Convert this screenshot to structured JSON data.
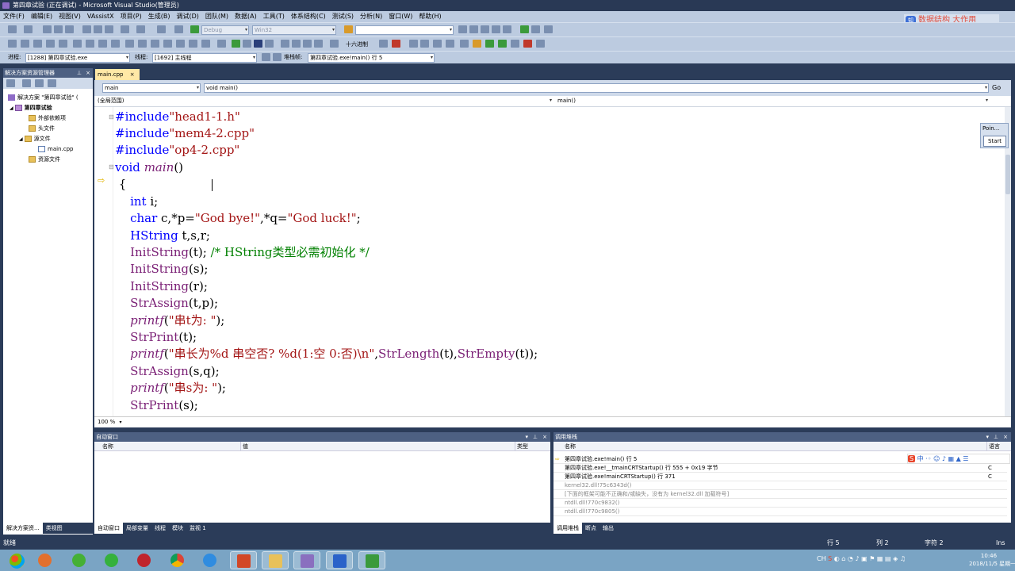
{
  "window": {
    "title": "第四章试验 (正在调试) - Microsoft Visual Studio(管理员)"
  },
  "menu": [
    "文件(F)",
    "编辑(E)",
    "视图(V)",
    "VAssistX",
    "项目(P)",
    "生成(B)",
    "调试(D)",
    "团队(M)",
    "数据(A)",
    "工具(T)",
    "体系结构(C)",
    "测试(S)",
    "分析(N)",
    "窗口(W)",
    "帮助(H)"
  ],
  "toolbar": {
    "config": "Debug",
    "platform": "Win32",
    "hex_label": "十六进制",
    "process_label": "进程:",
    "process_value": "[1288] 第四章试验.exe",
    "thread_label": "线程:",
    "thread_value": "[1692] 主线程",
    "stack_label": "堆栈帧:",
    "stack_value": "第四章试验.exe!main() 行 5"
  },
  "watermark": {
    "badge": "知",
    "text": "数据结构 大作用"
  },
  "solution_explorer": {
    "title": "解决方案资源管理器",
    "solution": "解决方案 \"第四章试验\" (",
    "project": "第四章试验",
    "ext_deps": "外部依赖项",
    "headers": "头文件",
    "sources": "源文件",
    "main_file": "main.cpp",
    "resources": "资源文件",
    "tab1": "解决方案资...",
    "tab2": "类视图"
  },
  "editor": {
    "tab": "main.cpp",
    "nav_left": "main",
    "nav_right": "void main()",
    "nav_go": "Go",
    "scope_left": "(全局范围)",
    "scope_right": "main()",
    "zoom": "100 %"
  },
  "code": [
    "#include\"head1-1.h\"",
    "#include\"mem4-2.cpp\"",
    "#include\"op4-2.cpp\"",
    "void main()",
    "{",
    "    int i;",
    "    char c,*p=\"God bye!\",*q=\"God luck!\";",
    "    HString t,s,r;",
    "    InitString(t); /* HString类型必需初始化 */",
    "    InitString(s);",
    "    InitString(r);",
    "    StrAssign(t,p);",
    "    printf(\"串t为: \");",
    "    StrPrint(t);",
    "    printf(\"串长为%d 串空否? %d(1:空 0:否)\\n\",StrLength(t),StrEmpty(t));",
    "    StrAssign(s,q);",
    "    printf(\"串s为: \");",
    "    StrPrint(s);"
  ],
  "point_box": {
    "title": "Poin...",
    "button": "Start"
  },
  "autos": {
    "title": "自动窗口",
    "col_name": "名称",
    "col_value": "值",
    "col_type": "类型",
    "tabs": [
      "自动窗口",
      "局部变量",
      "线程",
      "模块",
      "监视 1"
    ]
  },
  "callstack": {
    "title": "调用堆栈",
    "col_name": "名称",
    "col_lang": "语言",
    "rows": [
      {
        "name": "第四章试验.exe!main()  行 5",
        "lang": ""
      },
      {
        "name": "第四章试验.exe!__tmainCRTStartup()  行 555 + 0x19 字节",
        "lang": "C"
      },
      {
        "name": "第四章试验.exe!mainCRTStartup()  行 371",
        "lang": "C"
      },
      {
        "name": "kernel32.dll!75c6343d()",
        "lang": ""
      },
      {
        "name": "[下面的框架可能不正确和/或缺失，没有为 kernel32.dll 加载符号]",
        "lang": ""
      },
      {
        "name": "ntdll.dll!770c9832()",
        "lang": ""
      },
      {
        "name": "ntdll.dll!770c9805()",
        "lang": ""
      }
    ],
    "tabs": [
      "调用堆栈",
      "断点",
      "输出"
    ]
  },
  "status": {
    "ready": "就绪",
    "line": "行 5",
    "col": "列 2",
    "char": "字符 2",
    "ins": "Ins"
  },
  "taskbar": {
    "time": "10:46",
    "date": "2018/11/5 星期一"
  },
  "colors": {
    "title_bg": "#293955",
    "chrome": "#bccbe0",
    "keyword": "#0000ff",
    "comment": "#008000"
  }
}
